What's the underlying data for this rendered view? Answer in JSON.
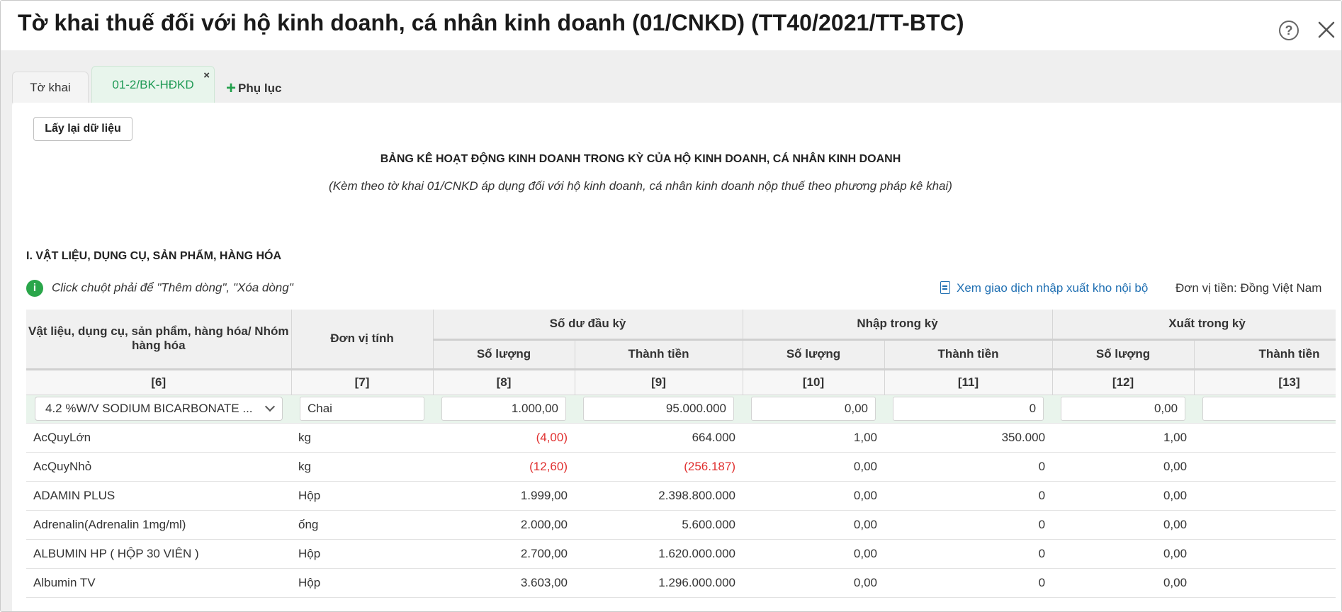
{
  "window": {
    "title": "Tờ khai thuế đối với hộ kinh doanh, cá nhân kinh doanh (01/CNKD) (TT40/2021/TT-BTC)",
    "help_icon": "question-circle-icon",
    "close_icon": "close-icon"
  },
  "tabs": [
    {
      "label": "Tờ khai",
      "active": false
    },
    {
      "label": "01-2/BK-HĐKD",
      "active": true,
      "close": "×"
    }
  ],
  "addendum": {
    "label": "Phụ lục",
    "icon": "plus-icon"
  },
  "toolbar": {
    "reload_label": "Lấy lại dữ liệu"
  },
  "report": {
    "title": "BẢNG KÊ HOẠT ĐỘNG KINH DOANH TRONG KỲ CỦA HỘ KINH DOANH, CÁ NHÂN KINH DOANH",
    "subtitle": "(Kèm theo tờ khai 01/CNKD áp dụng đối với hộ kinh doanh, cá nhân kinh doanh nộp thuế theo phương pháp kê khai)"
  },
  "section": {
    "title": "I. VẬT LIỆU, DỤNG CỤ, SẢN PHẨM, HÀNG HÓA",
    "hint_icon": "info-icon",
    "hint": "Click chuột phải để \"Thêm dòng\", \"Xóa dòng\"",
    "link_label": "Xem giao dịch nhập xuất kho nội bộ",
    "link_icon": "document-icon",
    "currency": "Đơn vị tiền: Đồng Việt Nam"
  },
  "table": {
    "headers": {
      "item": "Vật liệu, dụng cụ, sản phẩm, hàng hóa/ Nhóm hàng hóa",
      "unit": "Đơn vị tính",
      "opening": "Số dư đầu kỳ",
      "import": "Nhập trong kỳ",
      "export": "Xuất trong kỳ",
      "qty": "Số lượng",
      "amount": "Thành tiền"
    },
    "col_numbers": [
      "[6]",
      "[7]",
      "[8]",
      "[9]",
      "[10]",
      "[11]",
      "[12]",
      "[13]"
    ],
    "edit_row": {
      "item": "4.2 %W/V SODIUM BICARBONATE ...",
      "unit": "Chai",
      "open_qty": "1.000,00",
      "open_amt": "95.000.000",
      "in_qty": "0,00",
      "in_amt": "0",
      "out_qty": "0,00",
      "out_amt": ""
    },
    "rows": [
      {
        "item": "AcQuyLớn",
        "unit": "kg",
        "open_qty": "(4,00)",
        "open_amt": "664.000",
        "in_qty": "1,00",
        "in_amt": "350.000",
        "out_qty": "1,00",
        "out_amt": ""
      },
      {
        "item": "AcQuyNhỏ",
        "unit": "kg",
        "open_qty": "(12,60)",
        "open_amt": "(256.187)",
        "in_qty": "0,00",
        "in_amt": "0",
        "out_qty": "0,00",
        "out_amt": ""
      },
      {
        "item": "ADAMIN PLUS",
        "unit": "Hộp",
        "open_qty": "1.999,00",
        "open_amt": "2.398.800.000",
        "in_qty": "0,00",
        "in_amt": "0",
        "out_qty": "0,00",
        "out_amt": ""
      },
      {
        "item": "Adrenalin(Adrenalin 1mg/ml)",
        "unit": "ống",
        "open_qty": "2.000,00",
        "open_amt": "5.600.000",
        "in_qty": "0,00",
        "in_amt": "0",
        "out_qty": "0,00",
        "out_amt": ""
      },
      {
        "item": "ALBUMIN HP ( HỘP 30 VIÊN )",
        "unit": "Hộp",
        "open_qty": "2.700,00",
        "open_amt": "1.620.000.000",
        "in_qty": "0,00",
        "in_amt": "0",
        "out_qty": "0,00",
        "out_amt": ""
      },
      {
        "item": "Albumin TV",
        "unit": "Hộp",
        "open_qty": "3.603,00",
        "open_amt": "1.296.000.000",
        "in_qty": "0,00",
        "in_amt": "0",
        "out_qty": "0,00",
        "out_amt": ""
      }
    ]
  },
  "colors": {
    "accent": "#1f9a55",
    "negative": "#e0302f",
    "link": "#1f6fb2",
    "info": "#2aa64a"
  }
}
